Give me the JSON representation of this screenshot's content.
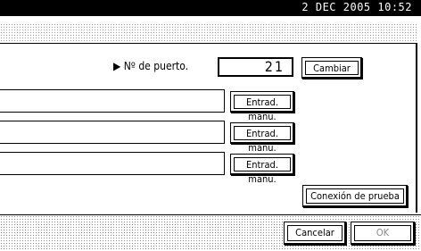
{
  "status_bar": {
    "datetime": "2 DEC  2005 10:52"
  },
  "port": {
    "label": "▶ Nº de puerto.",
    "value": "21",
    "change_button": "Cambiar"
  },
  "fields": [
    {
      "button": "Entrad. manu."
    },
    {
      "button": "Entrad. manu."
    },
    {
      "button": "Entrad. manu."
    }
  ],
  "test_connection_button": "Conexión de prueba",
  "footer": {
    "cancel_button": "Cancelar",
    "ok_button": "OK"
  }
}
